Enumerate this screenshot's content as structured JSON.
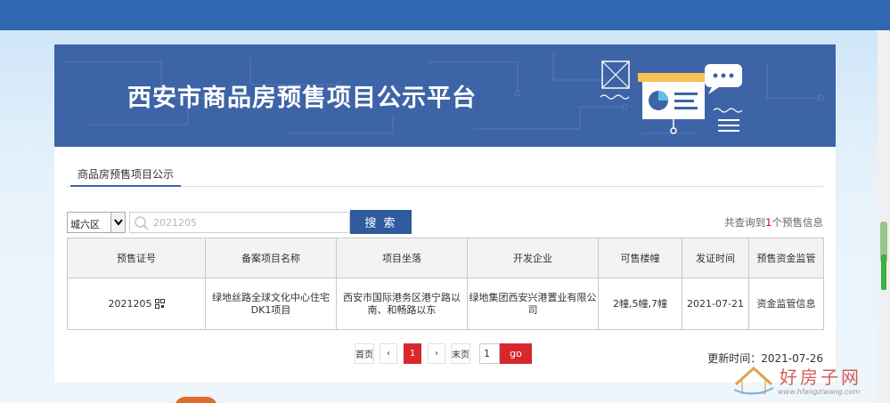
{
  "banner": {
    "title": "西安市商品房预售项目公示平台"
  },
  "tabs": [
    {
      "label": "商品房预售项目公示",
      "active": true
    }
  ],
  "filter": {
    "district_selected": "城六区",
    "search_placeholder": "2021205",
    "search_button": "搜 索",
    "result_prefix": "共查询到",
    "result_count": "1",
    "result_suffix": "个预售信息"
  },
  "table": {
    "columns": [
      "预售证号",
      "备案项目名称",
      "项目坐落",
      "开发企业",
      "可售楼幢",
      "发证时间",
      "预售资金监管"
    ],
    "rows": [
      {
        "cert_no": "2021205",
        "project_name": "绿地丝路全球文化中心住宅DK1项目",
        "location": "西安市国际港务区港宁路以南、和畅路以东",
        "developer": "绿地集团西安兴港置业有限公司",
        "buildings": "2幢,5幢,7幢",
        "issue_date": "2021-07-21",
        "fund_link": "资金监管信息"
      }
    ]
  },
  "pagination": {
    "first": "首页",
    "prev": "‹",
    "current": "1",
    "next": "›",
    "last": "末页",
    "page_input": "1",
    "go": "go"
  },
  "update_time": "更新时间：2021-07-26",
  "watermark": {
    "text": "好房子网",
    "url": "www.hfangziwang.com"
  },
  "colors": {
    "topbar": "#2f67b0",
    "banner": "#3d64a6",
    "search_button": "#2f5a9c",
    "accent_red": "#d9272e"
  }
}
